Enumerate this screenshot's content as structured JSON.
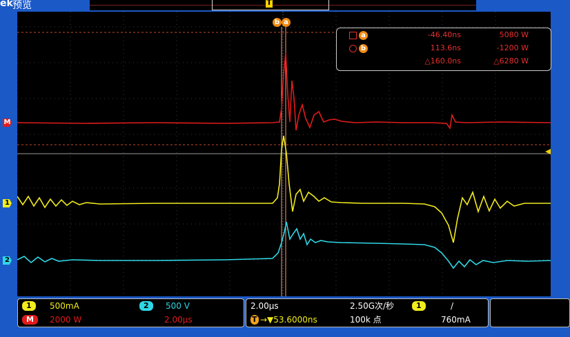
{
  "header": {
    "brand": "ek",
    "mode": "预览",
    "record_trigger_marker": "T"
  },
  "scale_indicators": {
    "math": "M",
    "ch1": "1",
    "ch2": "2"
  },
  "cursors": {
    "badge_b": "b",
    "badge_a": "a",
    "readout": {
      "a": {
        "id": "a",
        "time": "-46.40ns",
        "value": "5080 W"
      },
      "b": {
        "id": "b",
        "time": "113.6ns",
        "value": "-1200 W"
      },
      "delta": {
        "time": "△160.0ns",
        "value": "△6280 W"
      }
    }
  },
  "channels": {
    "ch1": {
      "num": "1",
      "scale": "500mA",
      "color": "#f2ec1d"
    },
    "ch2": {
      "num": "2",
      "scale": "500 V",
      "color": "#2fd7e6"
    },
    "math": {
      "num": "M",
      "scale": "2000 W",
      "time": "2.00μs",
      "color": "#e21b1b"
    }
  },
  "timebase": {
    "scale": "2.00μs",
    "sample_rate": "2.50G次/秒",
    "trigger_marker": "T",
    "position": "→▼53.6000ns",
    "record_length": "100k 点"
  },
  "trigger": {
    "source": "1",
    "slope": "/",
    "level": "760mA"
  }
}
